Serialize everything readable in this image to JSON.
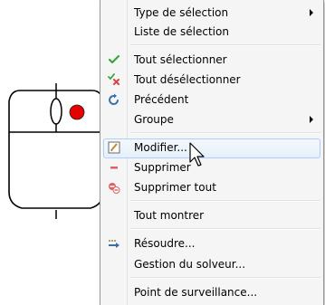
{
  "menu": {
    "items": [
      {
        "label": "Type de sélection",
        "icon": "",
        "submenu": true
      },
      {
        "label": "Liste de sélection",
        "icon": ""
      },
      {
        "label": "Tout sélectionner",
        "icon": "check-mark-icon"
      },
      {
        "label": "Tout désélectionner",
        "icon": "check-x-icon"
      },
      {
        "label": "Précédent",
        "icon": "previous-arrow-icon"
      },
      {
        "label": "Groupe",
        "icon": "",
        "submenu": true
      },
      {
        "label": "Modifier...",
        "icon": "edit-pencil-icon",
        "hovered": true
      },
      {
        "label": "Supprimer",
        "icon": "delete-minus-icon"
      },
      {
        "label": "Supprimer tout",
        "icon": "delete-all-icon"
      },
      {
        "label": "Tout montrer",
        "icon": ""
      },
      {
        "label": "Résoudre...",
        "icon": "solve-arrow-icon"
      },
      {
        "label": "Gestion du solveur...",
        "icon": ""
      },
      {
        "label": "Point de surveillance...",
        "icon": ""
      }
    ]
  },
  "illustration": {
    "name": "mouse-right-click",
    "highlight_color": "#e60000"
  },
  "colors": {
    "menu_background": "#f5f5f5",
    "hover_border": "#aecff7",
    "check_green": "#3aa63a",
    "delete_red": "#e04040"
  }
}
